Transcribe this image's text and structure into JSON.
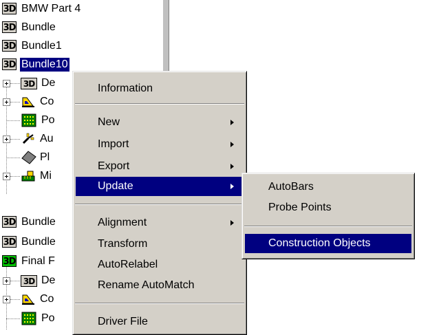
{
  "tree": {
    "items": [
      {
        "label": "BMW Part 4",
        "badge": "3D"
      },
      {
        "label": "Bundle",
        "badge": "3D"
      },
      {
        "label": "Bundle1",
        "badge": "3D"
      },
      {
        "label": "Bundle10",
        "badge": "3D",
        "selected": true
      },
      {
        "label": "De",
        "badge": "3D",
        "icon": "3d-part-icon",
        "expandable": true
      },
      {
        "label": "Co",
        "icon": "construction-icon",
        "expandable": true
      },
      {
        "label": "Po",
        "icon": "grid-points-icon"
      },
      {
        "label": "Au",
        "icon": "autobar-icon",
        "expandable": true
      },
      {
        "label": "Pl",
        "icon": "plane-icon"
      },
      {
        "label": "Mi",
        "icon": "measure-icon",
        "expandable": true
      },
      {
        "label": "Bundle",
        "badge": "3D"
      },
      {
        "label": "Bundle",
        "badge": "3D"
      },
      {
        "label": "Final F",
        "badge": "3D",
        "badge_color": "#00c000"
      },
      {
        "label": "De",
        "badge": "3D",
        "icon": "3d-part-icon",
        "expandable": true
      },
      {
        "label": "Co",
        "icon": "construction-icon",
        "expandable": true
      },
      {
        "label": "Po",
        "icon": "grid-points-icon"
      }
    ]
  },
  "context_menu": {
    "items": [
      {
        "label": "Information"
      },
      {
        "label": "New",
        "submenu": true
      },
      {
        "label": "Import",
        "submenu": true
      },
      {
        "label": "Export",
        "submenu": true
      },
      {
        "label": "Update",
        "submenu": true,
        "highlighted": true
      },
      {
        "label": "Alignment",
        "submenu": true
      },
      {
        "label": "Transform"
      },
      {
        "label": "AutoRelabel"
      },
      {
        "label": "Rename AutoMatch"
      },
      {
        "label": "Driver File"
      }
    ]
  },
  "update_submenu": {
    "items": [
      {
        "label": "AutoBars"
      },
      {
        "label": "Probe Points"
      },
      {
        "label": "Construction Objects",
        "highlighted": true
      }
    ]
  },
  "colors": {
    "selection": "#000080",
    "menu_face": "#d4d0c8",
    "green_badge": "#00c000"
  }
}
